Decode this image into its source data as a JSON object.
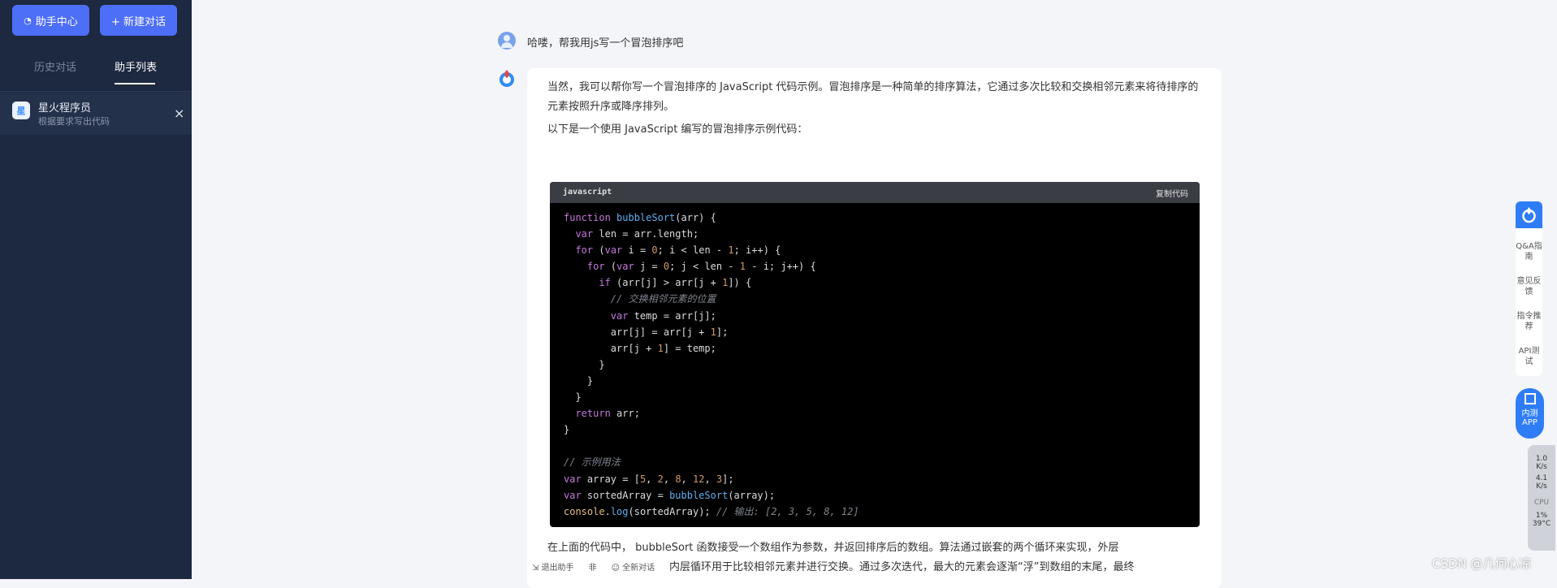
{
  "sidebar": {
    "assistant_center_label": "助手中心",
    "new_chat_label": "+ 新建对话",
    "tabs": [
      {
        "label": "历史对话"
      },
      {
        "label": "助手列表"
      }
    ],
    "assistant": {
      "icon_text": "星",
      "title": "星火程序员",
      "desc": "根据要求写出代码",
      "close_icon": "×"
    }
  },
  "chat": {
    "user_message": "哈喽，帮我用js写一个冒泡排序吧",
    "answer": {
      "para1": "当然，我可以帮你写一个冒泡排序的 JavaScript 代码示例。冒泡排序是一种简单的排序算法，它通过多次比较和交换相邻元素来将待排序的元素按照升序或降序排列。",
      "para2": "以下是一个使用 JavaScript 编写的冒泡排序示例代码：",
      "code_lang": "javascript",
      "copy_label": "复制代码",
      "para3_line1": "在上面的代码中， bubbleSort 函数接受一个数组作为参数，并返回排序后的数组。算法通过嵌套的两个循环来实现，外层",
      "para3_line2": "内层循环用于比较相邻元素并进行交换。通过多次迭代，最大的元素会逐渐“浮”到数组的末尾，最终"
    },
    "bottom": {
      "exit_label": "退出助手",
      "next_label": "非",
      "new_chat_label": "全新对话"
    }
  },
  "right_panel": {
    "items": [
      "Q&A指南",
      "意见反馈",
      "指令推荐",
      "API测试"
    ],
    "app_label_1": "内测",
    "app_label_2": "APP",
    "perf_1": "1.0",
    "perf_1_unit": "K/s",
    "perf_2": "4.1",
    "perf_2_unit": "K/s",
    "cpu_label": "CPU",
    "cpu_value": "1%",
    "temp_value": "39°C"
  },
  "watermark": "CSDN @几何心凉",
  "colors": {
    "accent": "#4d6ef6",
    "sidebar_bg": "#1d2940",
    "code_bg": "#000000"
  }
}
